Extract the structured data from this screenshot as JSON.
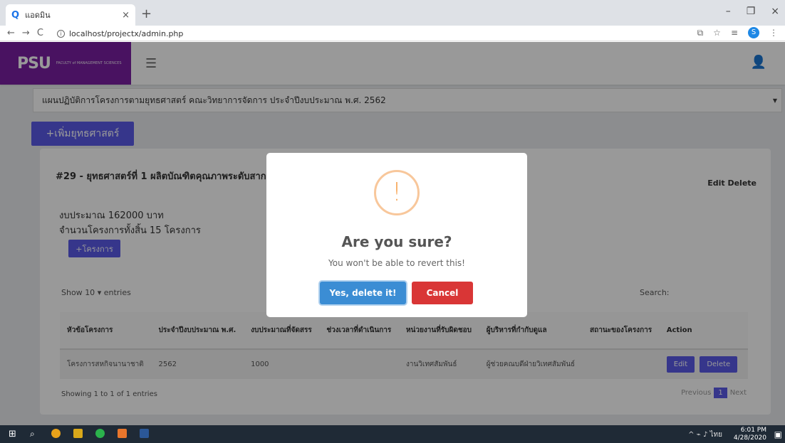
{
  "browser": {
    "tab_title": "แอดมิน",
    "tab_close": "×",
    "new_tab": "+",
    "url": "localhost/projectx/admin.php",
    "profile_initial": "S"
  },
  "topbar": {
    "logo_text": "PSU",
    "logo_sub": "FACULTY of MANAGEMENT SCIENCES"
  },
  "plan_select": {
    "value": "แผนปฏิบัติการโครงการตามยุทธศาสตร์ คณะวิทยาการจัดการ ประจำปีงบประมาณ พ.ศ. 2562"
  },
  "add_strategy_button": "+เพิ่มยุทธศาสตร์",
  "strategy": {
    "title": "#29 - ยุทธศาสตร์ที่ 1 ผลิตบัณฑิตคุณภาพระดับสากล",
    "edit": "Edit",
    "delete": "Delete",
    "budget": "งบประมาณ 162000 บาท",
    "project_count": "จำนวนโครงการทั้งสิ้น 15 โครงการ",
    "add_project": "+โครงการ"
  },
  "datatable": {
    "show_prefix": "Show",
    "show_value": "10",
    "show_suffix": "entries",
    "search_label": "Search:",
    "headers": [
      "หัวข้อโครงการ",
      "ประจำปีงบประมาณ พ.ศ.",
      "งบประมาณที่จัดสรร",
      "ช่วงเวลาที่ดำเนินการ",
      "หน่วยงานที่รับผิดชอบ",
      "ผู้บริหารที่กำกับดูแล",
      "สถานะของโครงการ",
      "Action"
    ],
    "rows": [
      {
        "title": "โครงการสหกิจนานาชาติ",
        "year": "2562",
        "budget": "1000",
        "period": "",
        "unit": "งานวิเทศสัมพันธ์",
        "executive": "ผู้ช่วยคณบดีฝ่ายวิเทศสัมพันธ์",
        "status": "",
        "edit": "Edit",
        "delete": "Delete"
      }
    ],
    "showing": "Showing 1 to 1 of 1 entries",
    "prev": "Previous",
    "page": "1",
    "next": "Next"
  },
  "modal": {
    "icon": "!",
    "title": "Are you sure?",
    "text": "You won't be able to revert this!",
    "confirm": "Yes, delete it!",
    "cancel": "Cancel"
  },
  "taskbar": {
    "lang": "ไทย",
    "time": "6:01 PM",
    "date": "4/28/2020"
  },
  "colors": {
    "brand": "#7b1fa2",
    "primary": "#5b5ae8",
    "confirm": "#3b8dd4",
    "cancel": "#d93636",
    "warning": "#f8a85a"
  }
}
